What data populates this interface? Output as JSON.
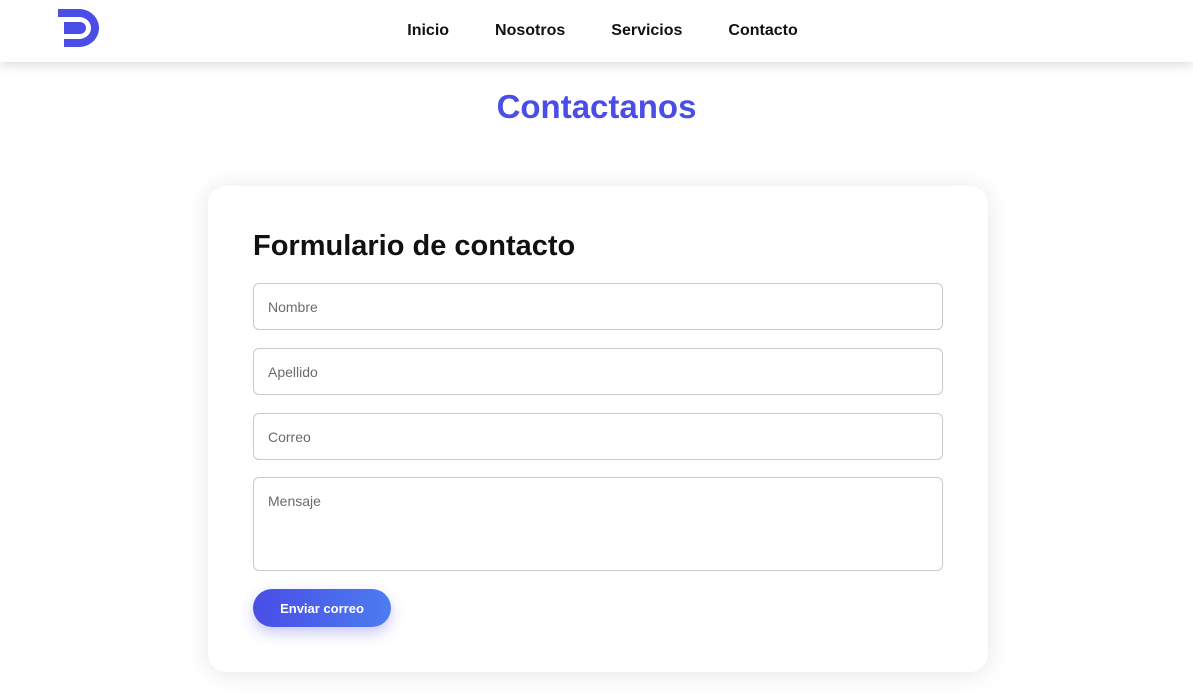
{
  "brand": {
    "logo_icon": "d-letter-logo-icon",
    "accent_color": "#4a4de6"
  },
  "nav": {
    "items": [
      {
        "label": "Inicio"
      },
      {
        "label": "Nosotros"
      },
      {
        "label": "Servicios"
      },
      {
        "label": "Contacto"
      }
    ]
  },
  "page": {
    "heading": "Contactanos"
  },
  "form": {
    "title": "Formulario de contacto",
    "fields": {
      "nombre": {
        "placeholder": "Nombre",
        "value": ""
      },
      "apellido": {
        "placeholder": "Apellido",
        "value": ""
      },
      "correo": {
        "placeholder": "Correo",
        "value": ""
      },
      "mensaje": {
        "placeholder": "Mensaje",
        "value": ""
      }
    },
    "submit_label": "Enviar correo"
  }
}
